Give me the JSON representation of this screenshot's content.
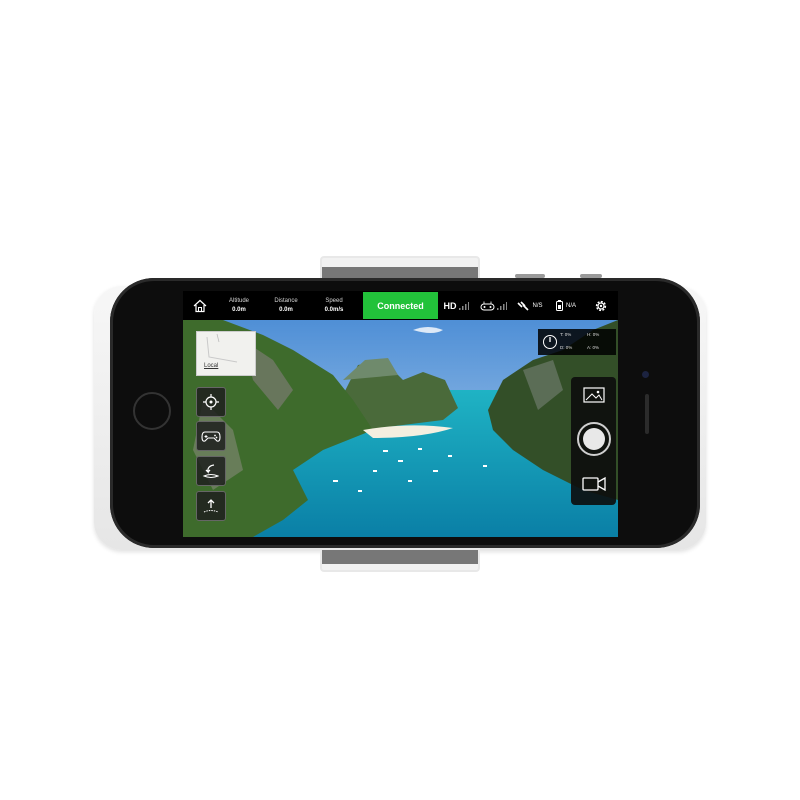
{
  "topbar": {
    "stats": [
      {
        "label": "Altitude",
        "value": "0.0m"
      },
      {
        "label": "Distance",
        "value": "0.0m"
      },
      {
        "label": "Speed",
        "value": "0.0m/s"
      }
    ],
    "connection_status": "Connected",
    "video_quality": "HD",
    "gps_status": "N/S",
    "battery_status": "N/A"
  },
  "map": {
    "local_label": "Local"
  },
  "telemetry": {
    "items": [
      "T: 0%",
      "H: 0%",
      "D: 0%",
      "A: 0%"
    ]
  },
  "icons": {
    "home": "home-icon",
    "settings": "gear-icon",
    "locate": "locate-target-icon",
    "gamepad": "gamepad-icon",
    "return_home": "return-home-icon",
    "takeoff": "takeoff-icon",
    "gallery": "gallery-icon",
    "shutter": "shutter-icon",
    "video": "video-camera-icon"
  },
  "colors": {
    "connected_bg": "#22c23a",
    "overlay_bg": "#141414"
  }
}
